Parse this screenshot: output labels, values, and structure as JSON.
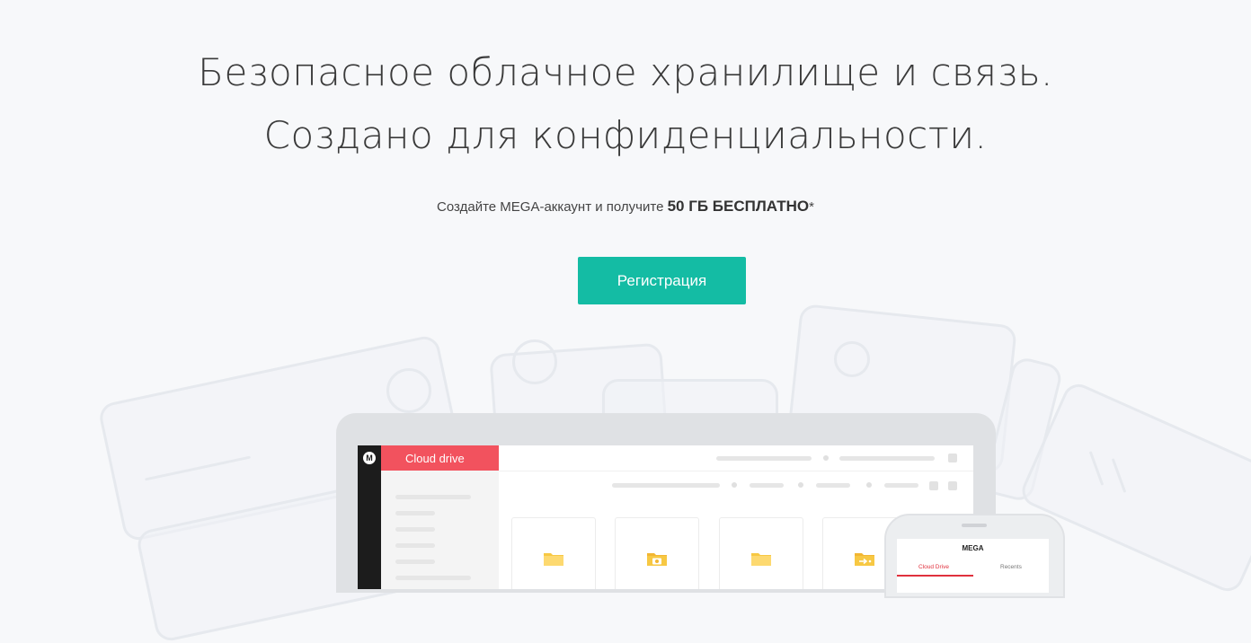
{
  "hero": {
    "title_line1": "Безопасное облачное хранилище и связь.",
    "title_line2": "Создано для конфиденциальности."
  },
  "offer": {
    "text": "Создайте MEGA-аккаунт и получите",
    "highlight": "50 ГБ БЕСПЛАТНО",
    "suffix": "*"
  },
  "cta": {
    "register_label": "Регистрация"
  },
  "app_mock": {
    "logo_letter": "M",
    "cloud_drive_label": "Cloud drive",
    "folder_icons": [
      "folder-icon",
      "camera-folder-icon",
      "folder-icon",
      "shared-folder-icon"
    ]
  },
  "phone_mock": {
    "title": "MEGA",
    "tab_active": "Cloud Drive",
    "tab_other": "Recents"
  },
  "colors": {
    "accent": "#14bca4",
    "cloud_drive_red": "#f2525e",
    "folder_yellow": "#f7c843",
    "background": "#f7f8fa"
  }
}
